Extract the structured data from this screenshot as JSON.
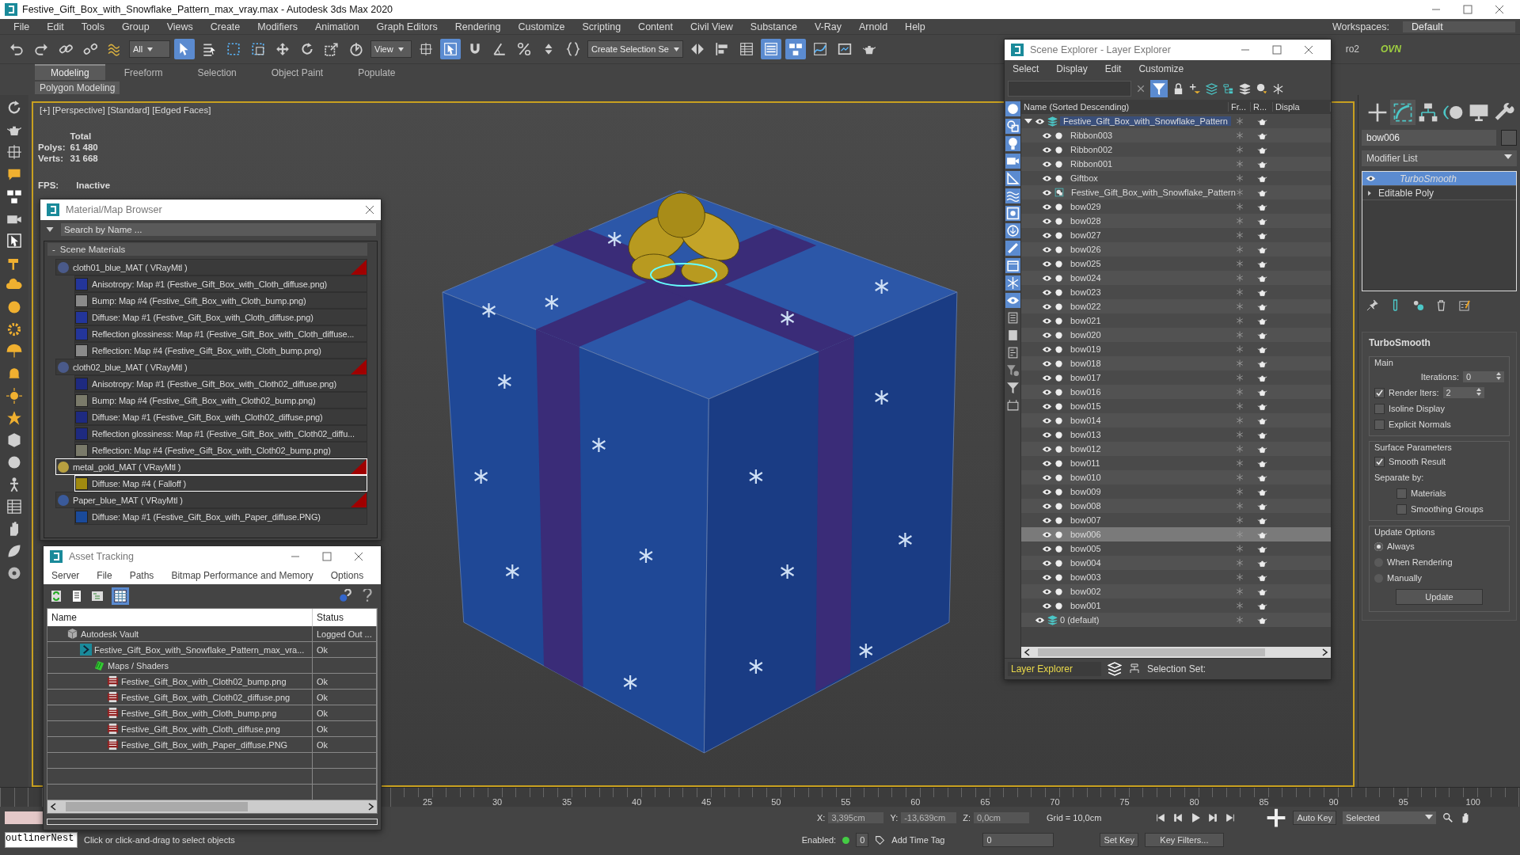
{
  "window": {
    "title": "Festive_Gift_Box_with_Snowflake_Pattern_max_vray.max - Autodesk 3ds Max 2020",
    "workspaces_label": "Workspaces:",
    "workspace": "Default"
  },
  "menu": [
    "File",
    "Edit",
    "Tools",
    "Group",
    "Views",
    "Create",
    "Modifiers",
    "Animation",
    "Graph Editors",
    "Rendering",
    "Customize",
    "Scripting",
    "Content",
    "Civil View",
    "Substance",
    "V-Ray",
    "Arnold",
    "Help"
  ],
  "toolbar": {
    "tools": [
      {
        "kind": "undo",
        "on": false
      },
      {
        "kind": "redo",
        "on": false
      },
      {
        "kind": "link",
        "on": false
      },
      {
        "kind": "unlink",
        "on": false
      },
      {
        "kind": "bind",
        "on": false
      },
      {
        "kind": "dropdown",
        "value": "All"
      },
      {
        "kind": "select",
        "on": true
      },
      {
        "kind": "select_name",
        "on": false
      },
      {
        "kind": "rect_region",
        "on": false
      },
      {
        "kind": "crossing",
        "on": false
      },
      {
        "kind": "move",
        "on": false
      },
      {
        "kind": "rotate",
        "on": false
      },
      {
        "kind": "scale",
        "on": false
      },
      {
        "kind": "place",
        "on": false
      },
      {
        "kind": "dropdown",
        "value": "View"
      },
      {
        "kind": "pivot",
        "on": false
      },
      {
        "kind": "manipulate",
        "on": true
      },
      {
        "kind": "snap",
        "on": false
      },
      {
        "kind": "angle_snap",
        "on": false
      },
      {
        "kind": "percent_snap",
        "on": false
      },
      {
        "kind": "spinner_snap",
        "on": false
      },
      {
        "kind": "named_sel",
        "on": false
      },
      {
        "kind": "dropdown",
        "value": "Create Selection Se"
      },
      {
        "kind": "mirror",
        "on": false
      },
      {
        "kind": "align",
        "on": false
      },
      {
        "kind": "layers",
        "on": false
      },
      {
        "kind": "ribbon",
        "on": true
      },
      {
        "kind": "schematic",
        "on": true
      },
      {
        "kind": "curve",
        "on": false
      },
      {
        "kind": "render_frame",
        "on": false
      },
      {
        "kind": "render",
        "on": false
      }
    ],
    "partial_label": "ro2",
    "badge": "OVN"
  },
  "ribbon": {
    "tabs": [
      {
        "label": "Modeling",
        "selected": true
      },
      {
        "label": "Freeform",
        "selected": false
      },
      {
        "label": "Selection",
        "selected": false
      },
      {
        "label": "Object Paint",
        "selected": false
      },
      {
        "label": "Populate",
        "selected": false
      }
    ],
    "panel": "Polygon Modeling"
  },
  "viewport": {
    "label": "[+] [Perspective] [Standard] [Edged Faces]",
    "stats_title": "Total",
    "stats": [
      {
        "label": "Polys:",
        "value": "61 480"
      },
      {
        "label": "Verts:",
        "value": "31 668"
      }
    ],
    "fps_label": "FPS:",
    "fps_value": "Inactive"
  },
  "material_browser": {
    "title": "Material/Map Browser",
    "search": {
      "placeholder": "Search by Name ..."
    },
    "group_toggle": "-",
    "group": "Scene Materials",
    "materials": [
      {
        "name": "cloth01_blue_MAT ( VRayMtl )",
        "color": "#4a5a8a",
        "selected": false,
        "maps": [
          {
            "label": "Anisotropy: Map #1 (Festive_Gift_Box_with_Cloth_diffuse.png)",
            "color": "#23359a",
            "selected": false
          },
          {
            "label": "Bump: Map #4 (Festive_Gift_Box_with_Cloth_bump.png)",
            "color": "#8a8a8a",
            "selected": false
          },
          {
            "label": "Diffuse: Map #1 (Festive_Gift_Box_with_Cloth_diffuse.png)",
            "color": "#23359a",
            "selected": false
          },
          {
            "label": "Reflection glossiness: Map #1 (Festive_Gift_Box_with_Cloth_diffuse...",
            "color": "#23359a",
            "selected": false
          },
          {
            "label": "Reflection: Map #4 (Festive_Gift_Box_with_Cloth_bump.png)",
            "color": "#8a8a8a",
            "selected": false
          }
        ]
      },
      {
        "name": "cloth02_blue_MAT ( VRayMtl )",
        "color": "#4a5a8a",
        "selected": false,
        "maps": [
          {
            "label": "Anisotropy: Map #1 (Festive_Gift_Box_with_Cloth02_diffuse.png)",
            "color": "#1e2a80",
            "selected": false
          },
          {
            "label": "Bump: Map #4 (Festive_Gift_Box_with_Cloth02_bump.png)",
            "color": "#7a7a6a",
            "selected": false
          },
          {
            "label": "Diffuse: Map #1 (Festive_Gift_Box_with_Cloth02_diffuse.png)",
            "color": "#1e2a80",
            "selected": false
          },
          {
            "label": "Reflection glossiness: Map #1 (Festive_Gift_Box_with_Cloth02_diffu...",
            "color": "#1e2a80",
            "selected": false
          },
          {
            "label": "Reflection: Map #4 (Festive_Gift_Box_with_Cloth02_bump.png)",
            "color": "#7a7a6a",
            "selected": false
          }
        ]
      },
      {
        "name": "metal_gold_MAT ( VRayMtl )",
        "color": "#b8a040",
        "selected": true,
        "maps": [
          {
            "label": "Diffuse: Map #4 ( Falloff )",
            "color": "#a08a10",
            "selected": true
          }
        ]
      },
      {
        "name": "Paper_blue_MAT ( VRayMtl )",
        "color": "#3a5a9a",
        "selected": false,
        "maps": [
          {
            "label": "Diffuse: Map #1 (Festive_Gift_Box_with_Paper_diffuse.PNG)",
            "color": "#1a4a9a",
            "selected": false
          }
        ]
      }
    ]
  },
  "asset_tracking": {
    "title": "Asset Tracking",
    "menu": [
      "Server",
      "File",
      "Paths",
      "Bitmap Performance and Memory",
      "Options"
    ],
    "columns": [
      "Name",
      "Status"
    ],
    "rows": [
      {
        "kind": "vault",
        "name": "Autodesk Vault",
        "status": "Logged Out ...",
        "children": [
          {
            "kind": "scene",
            "name": "Festive_Gift_Box_with_Snowflake_Pattern_max_vra...",
            "status": "Ok",
            "children": [
              {
                "kind": "folder",
                "name": "Maps / Shaders",
                "children": [
                  {
                    "kind": "png",
                    "name": "Festive_Gift_Box_with_Cloth02_bump.png",
                    "status": "Ok"
                  },
                  {
                    "kind": "png",
                    "name": "Festive_Gift_Box_with_Cloth02_diffuse.png",
                    "status": "Ok"
                  },
                  {
                    "kind": "png",
                    "name": "Festive_Gift_Box_with_Cloth_bump.png",
                    "status": "Ok"
                  },
                  {
                    "kind": "png",
                    "name": "Festive_Gift_Box_with_Cloth_diffuse.png",
                    "status": "Ok"
                  },
                  {
                    "kind": "png",
                    "name": "Festive_Gift_Box_with_Paper_diffuse.PNG",
                    "status": "Ok"
                  }
                ]
              }
            ]
          }
        ]
      }
    ]
  },
  "scene_explorer": {
    "title": "Scene Explorer - Layer Explorer",
    "menu": [
      "Select",
      "Display",
      "Edit",
      "Customize"
    ],
    "filters": [
      {
        "kind": "geometry",
        "on": true
      },
      {
        "kind": "shapes",
        "on": true
      },
      {
        "kind": "lights",
        "on": true
      },
      {
        "kind": "cameras",
        "on": true
      },
      {
        "kind": "helpers",
        "on": true
      },
      {
        "kind": "spacewarps",
        "on": true
      },
      {
        "kind": "groups",
        "on": true
      },
      {
        "kind": "xrefs",
        "on": true
      },
      {
        "kind": "bones",
        "on": true
      },
      {
        "kind": "containers",
        "on": true
      },
      {
        "kind": "frozen",
        "on": true
      },
      {
        "kind": "hidden",
        "on": true
      },
      {
        "kind": "all",
        "on": false
      },
      {
        "kind": "none",
        "on": false
      },
      {
        "kind": "invert",
        "on": false
      },
      {
        "kind": "filter_settings",
        "on": false
      },
      {
        "kind": "filter",
        "on": false
      },
      {
        "kind": "dependents",
        "on": false
      }
    ],
    "columns": [
      "Name (Sorted Descending)",
      "Fr...",
      "R...",
      "Displa"
    ],
    "layers": [
      {
        "name": "Festive_Gift_Box_with_Snowflake_Pattern",
        "kind": "layer",
        "expanded": true,
        "current": true,
        "children": [
          {
            "name": "Ribbon003",
            "kind": "object",
            "selected": false
          },
          {
            "name": "Ribbon002",
            "kind": "object",
            "selected": false
          },
          {
            "name": "Ribbon001",
            "kind": "object",
            "selected": false
          },
          {
            "name": "Giftbox",
            "kind": "object",
            "selected": false
          },
          {
            "name": "Festive_Gift_Box_with_Snowflake_Pattern",
            "kind": "container",
            "selected": false
          },
          {
            "name": "bow029",
            "kind": "object",
            "selected": false
          },
          {
            "name": "bow028",
            "kind": "object",
            "selected": false
          },
          {
            "name": "bow027",
            "kind": "object",
            "selected": false
          },
          {
            "name": "bow026",
            "kind": "object",
            "selected": false
          },
          {
            "name": "bow025",
            "kind": "object",
            "selected": false
          },
          {
            "name": "bow024",
            "kind": "object",
            "selected": false
          },
          {
            "name": "bow023",
            "kind": "object",
            "selected": false
          },
          {
            "name": "bow022",
            "kind": "object",
            "selected": false
          },
          {
            "name": "bow021",
            "kind": "object",
            "selected": false
          },
          {
            "name": "bow020",
            "kind": "object",
            "selected": false
          },
          {
            "name": "bow019",
            "kind": "object",
            "selected": false
          },
          {
            "name": "bow018",
            "kind": "object",
            "selected": false
          },
          {
            "name": "bow017",
            "kind": "object",
            "selected": false
          },
          {
            "name": "bow016",
            "kind": "object",
            "selected": false
          },
          {
            "name": "bow015",
            "kind": "object",
            "selected": false
          },
          {
            "name": "bow014",
            "kind": "object",
            "selected": false
          },
          {
            "name": "bow013",
            "kind": "object",
            "selected": false
          },
          {
            "name": "bow012",
            "kind": "object",
            "selected": false
          },
          {
            "name": "bow011",
            "kind": "object",
            "selected": false
          },
          {
            "name": "bow010",
            "kind": "object",
            "selected": false
          },
          {
            "name": "bow009",
            "kind": "object",
            "selected": false
          },
          {
            "name": "bow008",
            "kind": "object",
            "selected": false
          },
          {
            "name": "bow007",
            "kind": "object",
            "selected": false
          },
          {
            "name": "bow006",
            "kind": "object",
            "selected": true
          },
          {
            "name": "bow005",
            "kind": "object",
            "selected": false
          },
          {
            "name": "bow004",
            "kind": "object",
            "selected": false
          },
          {
            "name": "bow003",
            "kind": "object",
            "selected": false
          },
          {
            "name": "bow002",
            "kind": "object",
            "selected": false
          },
          {
            "name": "bow001",
            "kind": "object",
            "selected": false
          }
        ]
      },
      {
        "name": "0 (default)",
        "kind": "layer",
        "expanded": false,
        "current": false
      }
    ],
    "footer": {
      "mode": "Layer Explorer",
      "selection_set_label": "Selection Set:"
    }
  },
  "command_panel": {
    "tabs": [
      {
        "kind": "create",
        "selected": false
      },
      {
        "kind": "modify",
        "selected": true
      },
      {
        "kind": "hierarchy",
        "selected": false
      },
      {
        "kind": "motion",
        "selected": false
      },
      {
        "kind": "display",
        "selected": false
      },
      {
        "kind": "utilities",
        "selected": false
      }
    ],
    "object_name": "bow006",
    "modifier_list": "Modifier List",
    "stack": [
      {
        "label": "TurboSmooth",
        "kind": "modifier",
        "selected": true
      },
      {
        "label": "Editable Poly",
        "kind": "base",
        "selected": false
      }
    ],
    "rollout": {
      "title": "TurboSmooth",
      "groups": [
        {
          "title": "Main",
          "items": [
            {
              "kind": "spinner",
              "label": "Iterations:",
              "value": "0"
            },
            {
              "kind": "check_spinner",
              "label": "Render Iters:",
              "value": "2",
              "checked": true
            },
            {
              "kind": "checkbox",
              "label": "Isoline Display",
              "checked": false
            },
            {
              "kind": "checkbox",
              "label": "Explicit Normals",
              "checked": false
            }
          ]
        },
        {
          "title": "Surface Parameters",
          "items": [
            {
              "kind": "checkbox",
              "label": "Smooth Result",
              "checked": true
            },
            {
              "kind": "text",
              "label": "Separate by:"
            },
            {
              "kind": "sub_checkbox",
              "label": "Materials",
              "checked": false
            },
            {
              "kind": "sub_checkbox",
              "label": "Smoothing Groups",
              "checked": false
            }
          ]
        },
        {
          "title": "Update Options",
          "items": [
            {
              "kind": "radio",
              "label": "Always",
              "selected": true
            },
            {
              "kind": "radio",
              "label": "When Rendering",
              "selected": false
            },
            {
              "kind": "radio",
              "label": "Manually",
              "selected": false
            },
            {
              "kind": "button",
              "label": "Update"
            }
          ]
        }
      ]
    }
  },
  "timeline": {
    "ticks": [
      "25",
      "30",
      "35",
      "40",
      "45",
      "50",
      "55",
      "60",
      "65",
      "70",
      "75",
      "80",
      "85",
      "90",
      "95",
      "100"
    ]
  },
  "status": {
    "command_field": "outlinerNest",
    "prompt": "Click or click-and-drag to select objects",
    "coords": [
      {
        "label": "X:",
        "value": "3,395cm"
      },
      {
        "label": "Y:",
        "value": "-13,639cm"
      },
      {
        "label": "Z:",
        "value": "0,0cm"
      }
    ],
    "grid": "Grid = 10,0cm",
    "enabled_label": "Enabled:",
    "enabled_value": "0",
    "time_tag": "Add Time Tag",
    "frame": "0",
    "auto_key": "Auto Key",
    "key_mode": "Selected",
    "set_key": "Set Key",
    "key_filters": "Key Filters..."
  }
}
